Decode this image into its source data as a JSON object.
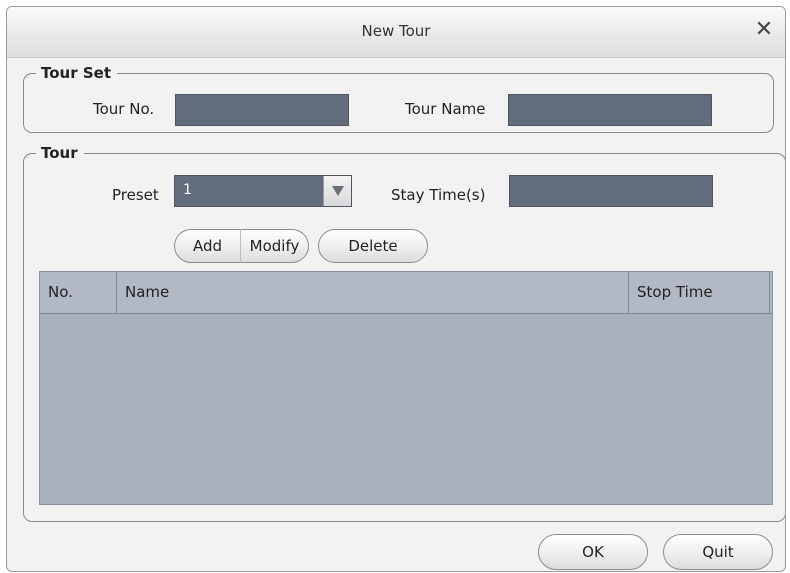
{
  "dialog": {
    "title": "New Tour",
    "close_symbol": "✕"
  },
  "tour_set": {
    "legend": "Tour Set",
    "tour_no_label": "Tour No.",
    "tour_no_value": "",
    "tour_name_label": "Tour Name",
    "tour_name_value": ""
  },
  "tour": {
    "legend": "Tour",
    "preset_label": "Preset",
    "preset_value": "1",
    "stay_time_label": "Stay Time(s)",
    "stay_time_value": "",
    "add_label": "Add",
    "modify_label": "Modify",
    "delete_label": "Delete"
  },
  "table": {
    "columns": [
      "No.",
      "Name",
      "Stop Time"
    ],
    "rows": []
  },
  "footer": {
    "ok_label": "OK",
    "quit_label": "Quit"
  },
  "colors": {
    "field_bg": "#636c7a",
    "table_bg": "#a9afbd",
    "header_bg": "#b3b8c5"
  },
  "icons": {
    "close": "close-icon",
    "dropdown": "chevron-down-icon"
  }
}
